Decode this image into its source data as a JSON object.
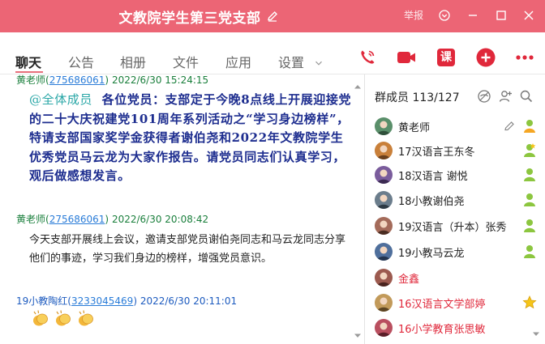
{
  "window": {
    "title": "文教院学生第三党支部",
    "report": "举报",
    "colors": {
      "titlebar": "#ec6575",
      "accent": "#e0283b"
    }
  },
  "tabs": [
    "聊天",
    "公告",
    "相册",
    "文件",
    "应用",
    "设置"
  ],
  "actions": {
    "course_label": "课"
  },
  "chat": {
    "messages": [
      {
        "sender": "黄老师",
        "qq_open": "(",
        "qq": "275686061",
        "qq_close": ")",
        "time": "2022/6/30 15:24:15",
        "mention": "@全体成员",
        "text": "各位党员：支部定于今晚8点线上开展迎接党的二十大庆祝建党101周年系列活动之“学习身边榜样”，特请支部国家奖学金获得者谢伯尧和2022年文教院学生优秀党员马云龙为大家作报告。请党员同志们认真学习，观后做感想发言。"
      },
      {
        "sender": "黄老师",
        "qq_open": "(",
        "qq": "275686061",
        "qq_close": ")",
        "time": "2022/6/30 20:08:42",
        "text": "今天支部开展线上会议，邀请支部党员谢伯尧同志和马云龙同志分享他们的事迹，学习我们身边的榜样，增强党员意识。"
      },
      {
        "sender": "19小教陶红",
        "qq_open": "(",
        "qq": "3233045469",
        "qq_close": ")",
        "time": "2022/6/30 20:11:01",
        "emoji": [
          "clapping-hands",
          "clapping-hands",
          "clapping-hands"
        ]
      }
    ]
  },
  "members": {
    "title": "群成员 113/127",
    "list": [
      {
        "name": "黄老师",
        "avatar_color": "#5a8f6a",
        "badge": "owner",
        "red": false
      },
      {
        "name": "17汉语言王东冬",
        "avatar_color": "#c9803a",
        "badge": "admin",
        "red": false
      },
      {
        "name": "18汉语言 谢悦",
        "avatar_color": "#7a5c9c",
        "badge": "member",
        "red": false
      },
      {
        "name": "18小教谢伯尧",
        "avatar_color": "#6b7d8c",
        "badge": "member",
        "red": false
      },
      {
        "name": "19汉语言（升本）张秀",
        "avatar_color": "#a46b5a",
        "badge": "member",
        "red": false
      },
      {
        "name": "19小教马云龙",
        "avatar_color": "#4f6f9c",
        "badge": "member",
        "red": false
      },
      {
        "name": "金鑫",
        "avatar_color": "#9c5a4f",
        "badge": "none",
        "red": true
      },
      {
        "name": "16汉语言文学部婷",
        "avatar_color": "#c29a5a",
        "badge": "star",
        "red": true
      },
      {
        "name": "16小学教育张思敏",
        "avatar_color": "#b94f5f",
        "badge": "none",
        "red": true
      }
    ]
  }
}
